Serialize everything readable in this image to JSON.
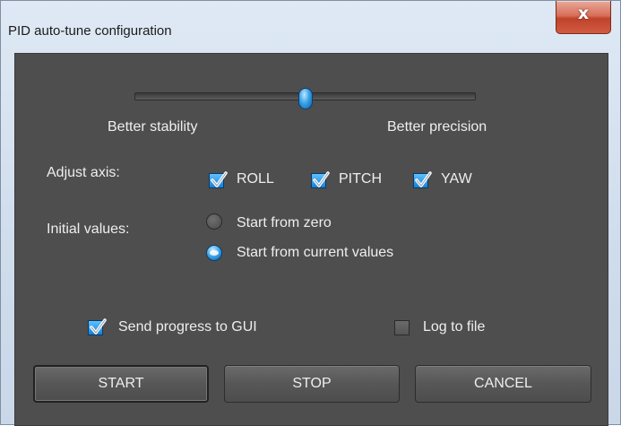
{
  "window": {
    "title": "PID auto-tune configuration",
    "close_glyph": "x"
  },
  "slider": {
    "left_label": "Better stability",
    "right_label": "Better precision",
    "value": 0.5
  },
  "axis": {
    "label": "Adjust axis:",
    "options": [
      {
        "label": "ROLL",
        "checked": true
      },
      {
        "label": "PITCH",
        "checked": true
      },
      {
        "label": "YAW",
        "checked": true
      }
    ]
  },
  "initial": {
    "label": "Initial values:",
    "options": [
      {
        "label": "Start from zero",
        "selected": false
      },
      {
        "label": "Start from current values",
        "selected": true
      }
    ]
  },
  "progress": {
    "label": "Send progress to GUI",
    "checked": true
  },
  "log": {
    "label": "Log to file",
    "checked": false
  },
  "buttons": {
    "start": "START",
    "stop": "STOP",
    "cancel": "CANCEL"
  },
  "colors": {
    "panel": "#4e4e4e",
    "accent": "#2a8de0",
    "text": "#eeeeee"
  }
}
